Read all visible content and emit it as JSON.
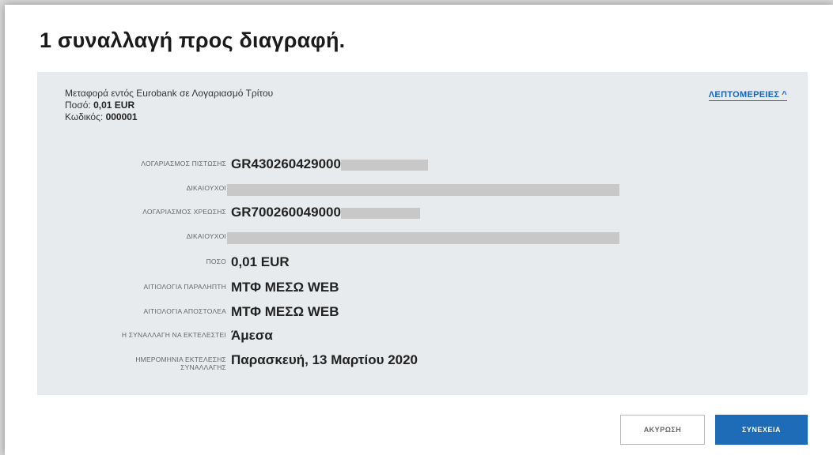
{
  "title": "1 συναλλαγή προς διαγραφή.",
  "summary": {
    "description": "Μεταφορά εντός Eurobank σε Λογαριασμό Τρίτου",
    "amount_label": "Ποσό:",
    "amount_value": "0,01 EUR",
    "code_label": "Κωδικός:",
    "code_value": "000001"
  },
  "details_toggle": {
    "label": "ΛΕΠΤΟΜΕΡΕΙΕΣ",
    "icon": "chevron-up-icon"
  },
  "rows": [
    {
      "label": "ΛΟΓΑΡΙΑΣΜΟΣ ΠΙΣΤΩΣΗΣ",
      "value": "GR430260429000"
    },
    {
      "label": "ΔΙΚΑΙΟΥΧΟΙ",
      "value": ""
    },
    {
      "label": "ΛΟΓΑΡΙΑΣΜΟΣ ΧΡΕΩΣΗΣ",
      "value": "GR700260049000"
    },
    {
      "label": "ΔΙΚΑΙΟΥΧΟΙ",
      "value": ""
    },
    {
      "label": "ΠΟΣΟ",
      "value": "0,01 EUR"
    },
    {
      "label": "ΑΙΤΙΟΛΟΓΙΑ ΠΑΡΑΛΗΠΤΗ",
      "value": "ΜΤΦ ΜΕΣΩ WEB"
    },
    {
      "label": "ΑΙΤΙΟΛΟΓΙΑ ΑΠΟΣΤΟΛΕΑ",
      "value": "ΜΤΦ ΜΕΣΩ WEB"
    },
    {
      "label": "Η ΣΥΝΑΛΛΑΓΗ ΝΑ ΕΚΤΕΛΕΣΤΕΙ",
      "value": "Άμεσα"
    },
    {
      "label": "ΗΜΕΡΟΜΗΝΙΑ ΕΚΤΕΛΕΣΗΣ ΣΥΝΑΛΛΑΓΗΣ",
      "value": "Παρασκευή, 13 Μαρτίου 2020"
    }
  ],
  "buttons": {
    "cancel": "ΑΚΥΡΩΣΗ",
    "continue": "ΣΥΝΕΧΕΙΑ"
  },
  "colors": {
    "accent": "#1e6bb8",
    "link": "#1565c0",
    "panel": "#e8ebed",
    "redacted": "#c8c8c8"
  }
}
